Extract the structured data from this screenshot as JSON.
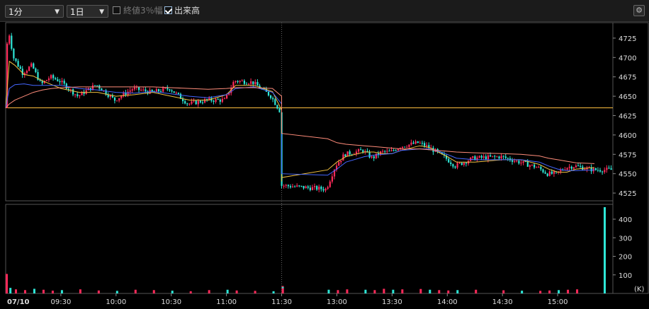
{
  "toolbar": {
    "interval": "1分",
    "range": "1日",
    "close3pct_label": "終値3％幅",
    "close3pct_checked": false,
    "volume_label": "出来高",
    "volume_checked": true,
    "settings_icon": "gear-icon"
  },
  "colors": {
    "up": "#ff2a5a",
    "down": "#2ee6d6",
    "ma_fast": "#f0c040",
    "ma_mid": "#4466ff",
    "ma_slow": "#ff8c7a",
    "ref": "#ffc040",
    "grid": "#444"
  },
  "chart_data": {
    "type": "candlestick",
    "date_label": "07/10",
    "price_axis": {
      "ylim": [
        4515,
        4745
      ],
      "ticks": [
        4525,
        4550,
        4575,
        4600,
        4625,
        4650,
        4675,
        4700,
        4725
      ]
    },
    "reference_price": 4635,
    "volume_axis": {
      "ylim": [
        0,
        480
      ],
      "ticks": [
        100,
        200,
        300,
        400
      ],
      "unit": "(K)"
    },
    "time_ticks": [
      "09:30",
      "10:00",
      "10:30",
      "11:00",
      "11:30",
      "13:00",
      "13:30",
      "14:00",
      "14:30",
      "15:00"
    ],
    "price_path": [
      [
        "09:00",
        4635
      ],
      [
        "09:02",
        4740
      ],
      [
        "09:05",
        4700
      ],
      [
        "09:10",
        4680
      ],
      [
        "09:15",
        4690
      ],
      [
        "09:20",
        4665
      ],
      [
        "09:25",
        4675
      ],
      [
        "09:30",
        4670
      ],
      [
        "09:40",
        4650
      ],
      [
        "09:50",
        4665
      ],
      [
        "10:00",
        4645
      ],
      [
        "10:10",
        4660
      ],
      [
        "10:20",
        4655
      ],
      [
        "10:30",
        4660
      ],
      [
        "10:40",
        4640
      ],
      [
        "10:50",
        4645
      ],
      [
        "11:00",
        4645
      ],
      [
        "11:05",
        4670
      ],
      [
        "11:15",
        4668
      ],
      [
        "11:25",
        4650
      ],
      [
        "11:30",
        4630
      ],
      [
        "11:35",
        4600
      ],
      [
        "11:40",
        4560
      ],
      [
        "11:45",
        4540
      ],
      [
        "11:50",
        4535
      ],
      [
        "12:55",
        4530
      ],
      [
        "13:00",
        4560
      ],
      [
        "13:05",
        4575
      ],
      [
        "13:15",
        4580
      ],
      [
        "13:20",
        4570
      ],
      [
        "13:25",
        4578
      ],
      [
        "13:30",
        4578
      ],
      [
        "13:35",
        4585
      ],
      [
        "13:45",
        4590
      ],
      [
        "13:50",
        4585
      ],
      [
        "13:55",
        4578
      ],
      [
        "14:00",
        4570
      ],
      [
        "14:05",
        4560
      ],
      [
        "14:15",
        4570
      ],
      [
        "14:30",
        4572
      ],
      [
        "14:40",
        4565
      ],
      [
        "14:50",
        4558
      ],
      [
        "14:55",
        4550
      ],
      [
        "15:00",
        4550
      ],
      [
        "15:05",
        4558
      ],
      [
        "15:10",
        4560
      ],
      [
        "15:20",
        4555
      ]
    ],
    "moving_averages": [
      {
        "key": "ma_fast",
        "values": [
          4635,
          4695,
          4690,
          4678,
          4676,
          4670,
          4665,
          4660,
          4655,
          4655,
          4650,
          4652,
          4655,
          4650,
          4645,
          4645,
          4652,
          4664,
          4664,
          4656,
          4632,
          4600,
          4560,
          4540,
          4545,
          4555,
          4565,
          4572,
          4578,
          4578,
          4576,
          4576,
          4580,
          4586,
          4584,
          4578,
          4572,
          4565,
          4565,
          4568,
          4568,
          4562,
          4556,
          4552,
          4552,
          4556,
          4558
        ]
      },
      {
        "key": "ma_mid",
        "values": [
          4635,
          4660,
          4665,
          4666,
          4664,
          4664,
          4664,
          4664,
          4660,
          4658,
          4655,
          4654,
          4656,
          4653,
          4650,
          4648,
          4652,
          4660,
          4662,
          4655,
          4640,
          4620,
          4590,
          4565,
          4550,
          4548,
          4556,
          4565,
          4572,
          4574,
          4575,
          4576,
          4580,
          4582,
          4582,
          4579,
          4575,
          4570,
          4568,
          4568,
          4568,
          4565,
          4560,
          4556,
          4554,
          4554,
          4555
        ]
      },
      {
        "key": "ma_slow",
        "values": [
          4635,
          4640,
          4645,
          4650,
          4655,
          4658,
          4660,
          4661,
          4662,
          4662,
          4662,
          4662,
          4662,
          4661,
          4660,
          4659,
          4660,
          4661,
          4661,
          4660,
          4650,
          4638,
          4625,
          4612,
          4602,
          4595,
          4590,
          4588,
          4586,
          4585,
          4584,
          4583,
          4582,
          4582,
          4581,
          4580,
          4579,
          4578,
          4577,
          4576,
          4575,
          4573,
          4570,
          4568,
          4566,
          4564,
          4563
        ]
      }
    ],
    "volume_bars_k": [
      105,
      30,
      22,
      18,
      25,
      20,
      15,
      18,
      22,
      16,
      14,
      20,
      18,
      15,
      12,
      18,
      20,
      16,
      14,
      12,
      30,
      40,
      35,
      28,
      25,
      20,
      18,
      22,
      20,
      18,
      25,
      20,
      22,
      24,
      20,
      18,
      16,
      18,
      20,
      17,
      15,
      14,
      16,
      18,
      20,
      22,
      465
    ]
  }
}
